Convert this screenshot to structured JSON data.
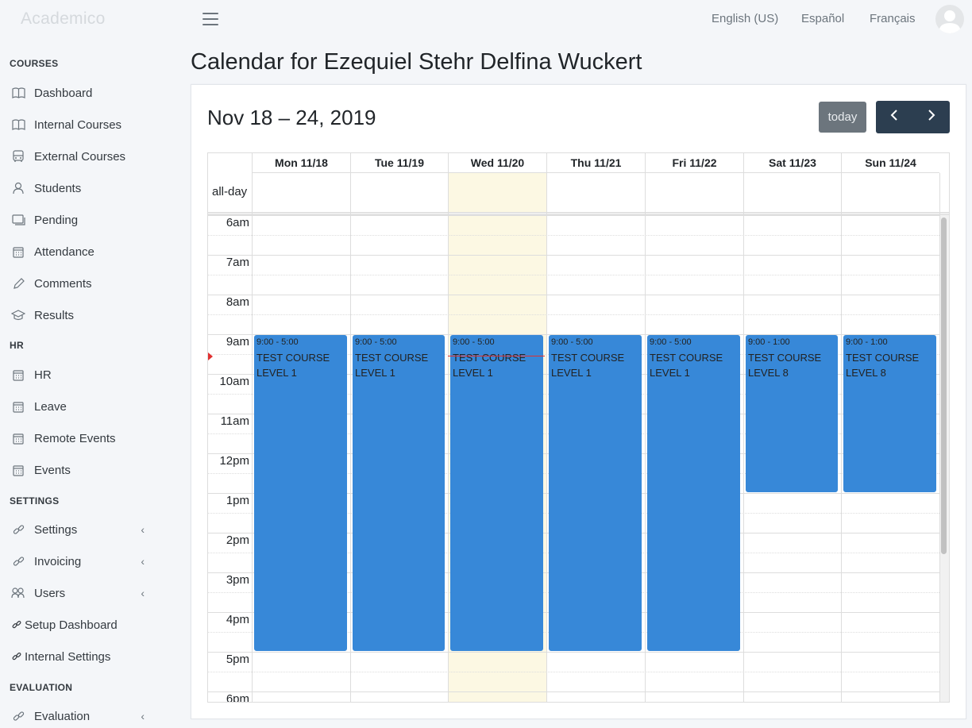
{
  "brand": "Academico",
  "topbar": {
    "languages": [
      "English (US)",
      "Español",
      "Français"
    ]
  },
  "sidebar": {
    "sections": {
      "courses": "COURSES",
      "hr": "HR",
      "settings": "SETTINGS",
      "evaluation": "EVALUATION"
    },
    "items": [
      {
        "label": "Dashboard",
        "icon": "book-icon"
      },
      {
        "label": "Internal Courses",
        "icon": "book-icon"
      },
      {
        "label": "External Courses",
        "icon": "bus-icon"
      },
      {
        "label": "Students",
        "icon": "user-icon"
      },
      {
        "label": "Pending",
        "icon": "window-icon"
      },
      {
        "label": "Attendance",
        "icon": "calendar-icon"
      },
      {
        "label": "Comments",
        "icon": "pencil-icon"
      },
      {
        "label": "Results",
        "icon": "graduation-cap-icon"
      },
      {
        "label": "HR",
        "icon": "calendar-icon"
      },
      {
        "label": "Leave",
        "icon": "calendar-icon"
      },
      {
        "label": "Remote Events",
        "icon": "calendar-icon"
      },
      {
        "label": "Events",
        "icon": "calendar-icon"
      },
      {
        "label": "Settings",
        "icon": "link-icon"
      },
      {
        "label": "Invoicing",
        "icon": "link-icon"
      },
      {
        "label": "Users",
        "icon": "users-icon"
      },
      {
        "label": "Setup Dashboard",
        "icon": "link-icon"
      },
      {
        "label": "Internal Settings",
        "icon": "link-icon"
      },
      {
        "label": "Evaluation",
        "icon": "link-icon"
      }
    ]
  },
  "page": {
    "title": "Calendar for Ezequiel Stehr Delfina Wuckert"
  },
  "calendar": {
    "range": "Nov 18 – 24, 2019",
    "today_label": "today",
    "allday_label": "all-day",
    "days": [
      "Mon 11/18",
      "Tue 11/19",
      "Wed 11/20",
      "Thu 11/21",
      "Fri 11/22",
      "Sat 11/23",
      "Sun 11/24"
    ],
    "today_index": 2,
    "times": [
      "6am",
      "7am",
      "8am",
      "9am",
      "10am",
      "11am",
      "12pm",
      "1pm",
      "2pm",
      "3pm",
      "4pm",
      "5pm",
      "6pm"
    ],
    "events": [
      {
        "day": 0,
        "time": "9:00 - 5:00",
        "title": "TEST COURSE LEVEL 1"
      },
      {
        "day": 1,
        "time": "9:00 - 5:00",
        "title": "TEST COURSE LEVEL 1"
      },
      {
        "day": 2,
        "time": "9:00 - 5:00",
        "title": "TEST COURSE LEVEL 1"
      },
      {
        "day": 3,
        "time": "9:00 - 5:00",
        "title": "TEST COURSE LEVEL 1"
      },
      {
        "day": 4,
        "time": "9:00 - 5:00",
        "title": "TEST COURSE LEVEL 1"
      },
      {
        "day": 5,
        "time": "9:00 - 1:00",
        "title": "TEST COURSE LEVEL 8"
      },
      {
        "day": 6,
        "time": "9:00 - 1:00",
        "title": "TEST COURSE LEVEL 8"
      }
    ],
    "event_color": "#3788d8",
    "today_color": "#fcf8e3",
    "now_indicator_color": "#e03030"
  }
}
